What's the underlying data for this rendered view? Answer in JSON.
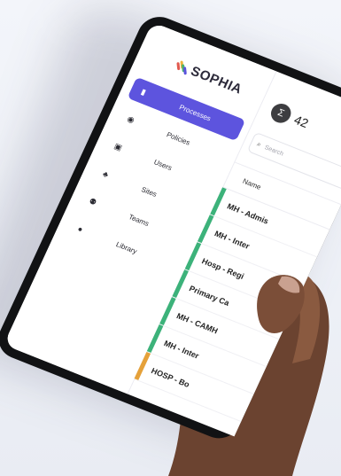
{
  "app": {
    "logo_text": "SOPHIA",
    "logo_colors": [
      "#e25a4f",
      "#f0b33c",
      "#48b36f",
      "#5b53dd"
    ]
  },
  "sidebar": {
    "items": [
      {
        "label": "Processes",
        "icon": "document-icon",
        "active": true
      },
      {
        "label": "Policies",
        "icon": "policy-icon",
        "active": false
      },
      {
        "label": "Users",
        "icon": "user-icon",
        "active": false
      },
      {
        "label": "Sites",
        "icon": "sites-icon",
        "active": false
      },
      {
        "label": "Teams",
        "icon": "team-icon",
        "active": false
      },
      {
        "label": "Library",
        "icon": "library-icon",
        "active": false
      }
    ]
  },
  "main": {
    "stat": {
      "icon": "sigma-icon",
      "value": "42"
    },
    "search": {
      "placeholder": "Search"
    },
    "table": {
      "column": "Name",
      "rows": [
        "MH - Admis",
        "MH - Inter",
        "Hosp - Regi",
        "Primary Ca",
        "MH - CAMH",
        "MH - Inter",
        "HOSP - Bo"
      ]
    }
  },
  "colors": {
    "accent": "#5d54de",
    "status_green": "#3cb27a",
    "status_orange": "#e5a13a"
  }
}
